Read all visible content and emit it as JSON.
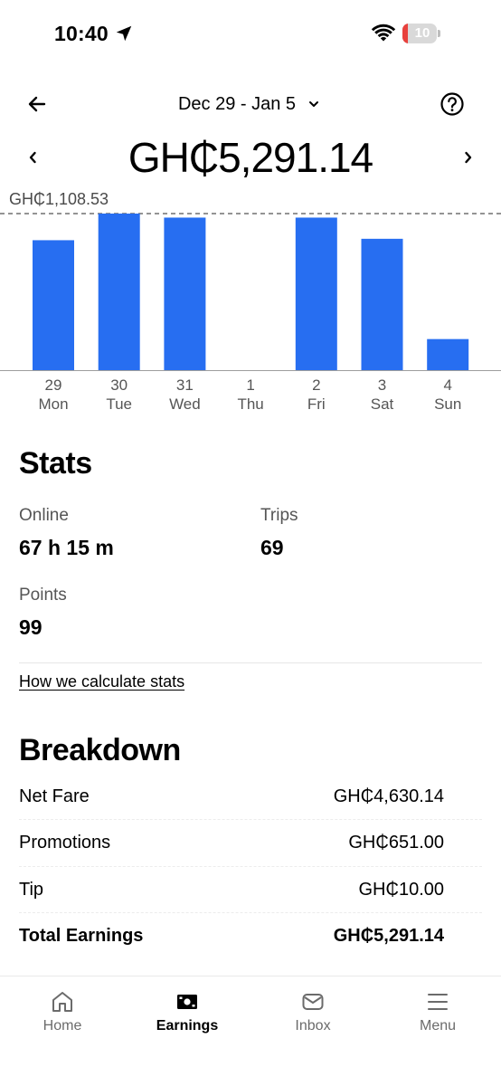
{
  "status_bar": {
    "time": "10:40",
    "battery_level": "10",
    "icons": [
      "location-arrow-icon",
      "wifi-icon",
      "battery-icon"
    ]
  },
  "header": {
    "date_range": "Dec 29 - Jan 5",
    "total": "GH₵5,291.14",
    "icons": [
      "back-arrow-icon",
      "chevron-down-icon",
      "help-icon",
      "chevron-left-icon",
      "chevron-right-icon"
    ]
  },
  "chart_data": {
    "type": "bar",
    "categories": [
      "29",
      "30",
      "31",
      "1",
      "2",
      "3",
      "4"
    ],
    "days": [
      "Mon",
      "Tue",
      "Wed",
      "Thu",
      "Fri",
      "Sat",
      "Sun"
    ],
    "values": [
      920,
      1108.53,
      1080,
      0,
      1080,
      930,
      220
    ],
    "max_label": "GH₵1,108.53",
    "ylim": [
      0,
      1108.53
    ],
    "color": "#276ef1",
    "grid": false
  },
  "stats": {
    "title": "Stats",
    "online_label": "Online",
    "online_value": "67 h 15 m",
    "trips_label": "Trips",
    "trips_value": "69",
    "points_label": "Points",
    "points_value": "99",
    "link": "How we calculate stats"
  },
  "breakdown": {
    "title": "Breakdown",
    "rows": [
      {
        "label": "Net Fare",
        "value": "GH₵4,630.14"
      },
      {
        "label": "Promotions",
        "value": "GH₵651.00"
      },
      {
        "label": "Tip",
        "value": "GH₵10.00"
      },
      {
        "label": "Total Earnings",
        "value": "GH₵5,291.14"
      }
    ]
  },
  "bottom_nav": {
    "items": [
      {
        "label": "Home",
        "icon": "home-icon"
      },
      {
        "label": "Earnings",
        "icon": "earnings-icon",
        "active": true
      },
      {
        "label": "Inbox",
        "icon": "inbox-icon"
      },
      {
        "label": "Menu",
        "icon": "menu-icon"
      }
    ]
  },
  "colors": {
    "accent_blue": "#276ef1",
    "battery_red": "#e8413d"
  }
}
